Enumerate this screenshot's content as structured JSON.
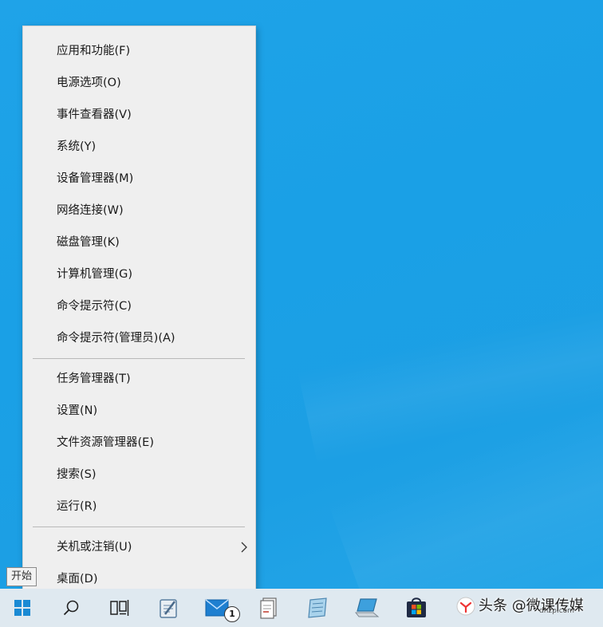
{
  "menu": {
    "items": [
      {
        "label": "应用和功能(F)"
      },
      {
        "label": "电源选项(O)"
      },
      {
        "label": "事件查看器(V)"
      },
      {
        "label": "系统(Y)"
      },
      {
        "label": "设备管理器(M)"
      },
      {
        "label": "网络连接(W)"
      },
      {
        "label": "磁盘管理(K)"
      },
      {
        "label": "计算机管理(G)"
      },
      {
        "label": "命令提示符(C)"
      },
      {
        "label": "命令提示符(管理员)(A)"
      },
      {
        "label": "任务管理器(T)"
      },
      {
        "label": "设置(N)"
      },
      {
        "label": "文件资源管理器(E)"
      },
      {
        "label": "搜索(S)"
      },
      {
        "label": "运行(R)"
      },
      {
        "label": "关机或注销(U)"
      },
      {
        "label": "桌面(D)"
      }
    ]
  },
  "tooltip": {
    "text": "开始"
  },
  "taskbar": {
    "buttons": [
      {
        "icon": "windows-start-icon"
      },
      {
        "icon": "search-icon"
      },
      {
        "icon": "task-view-icon"
      },
      {
        "icon": "notepad-pen-icon"
      },
      {
        "icon": "mail-icon"
      },
      {
        "icon": "document-icon"
      },
      {
        "icon": "notebook-icon"
      },
      {
        "icon": "laptop-icon"
      },
      {
        "icon": "store-icon"
      }
    ],
    "mail_badge": "1"
  },
  "watermark": {
    "text": "头条 @微课传媒",
    "subtext": "dnzp.com"
  },
  "colors": {
    "desktop": "#1fa3e8",
    "menu_bg": "#efefef",
    "taskbar_bg": "#dfe9f0"
  }
}
